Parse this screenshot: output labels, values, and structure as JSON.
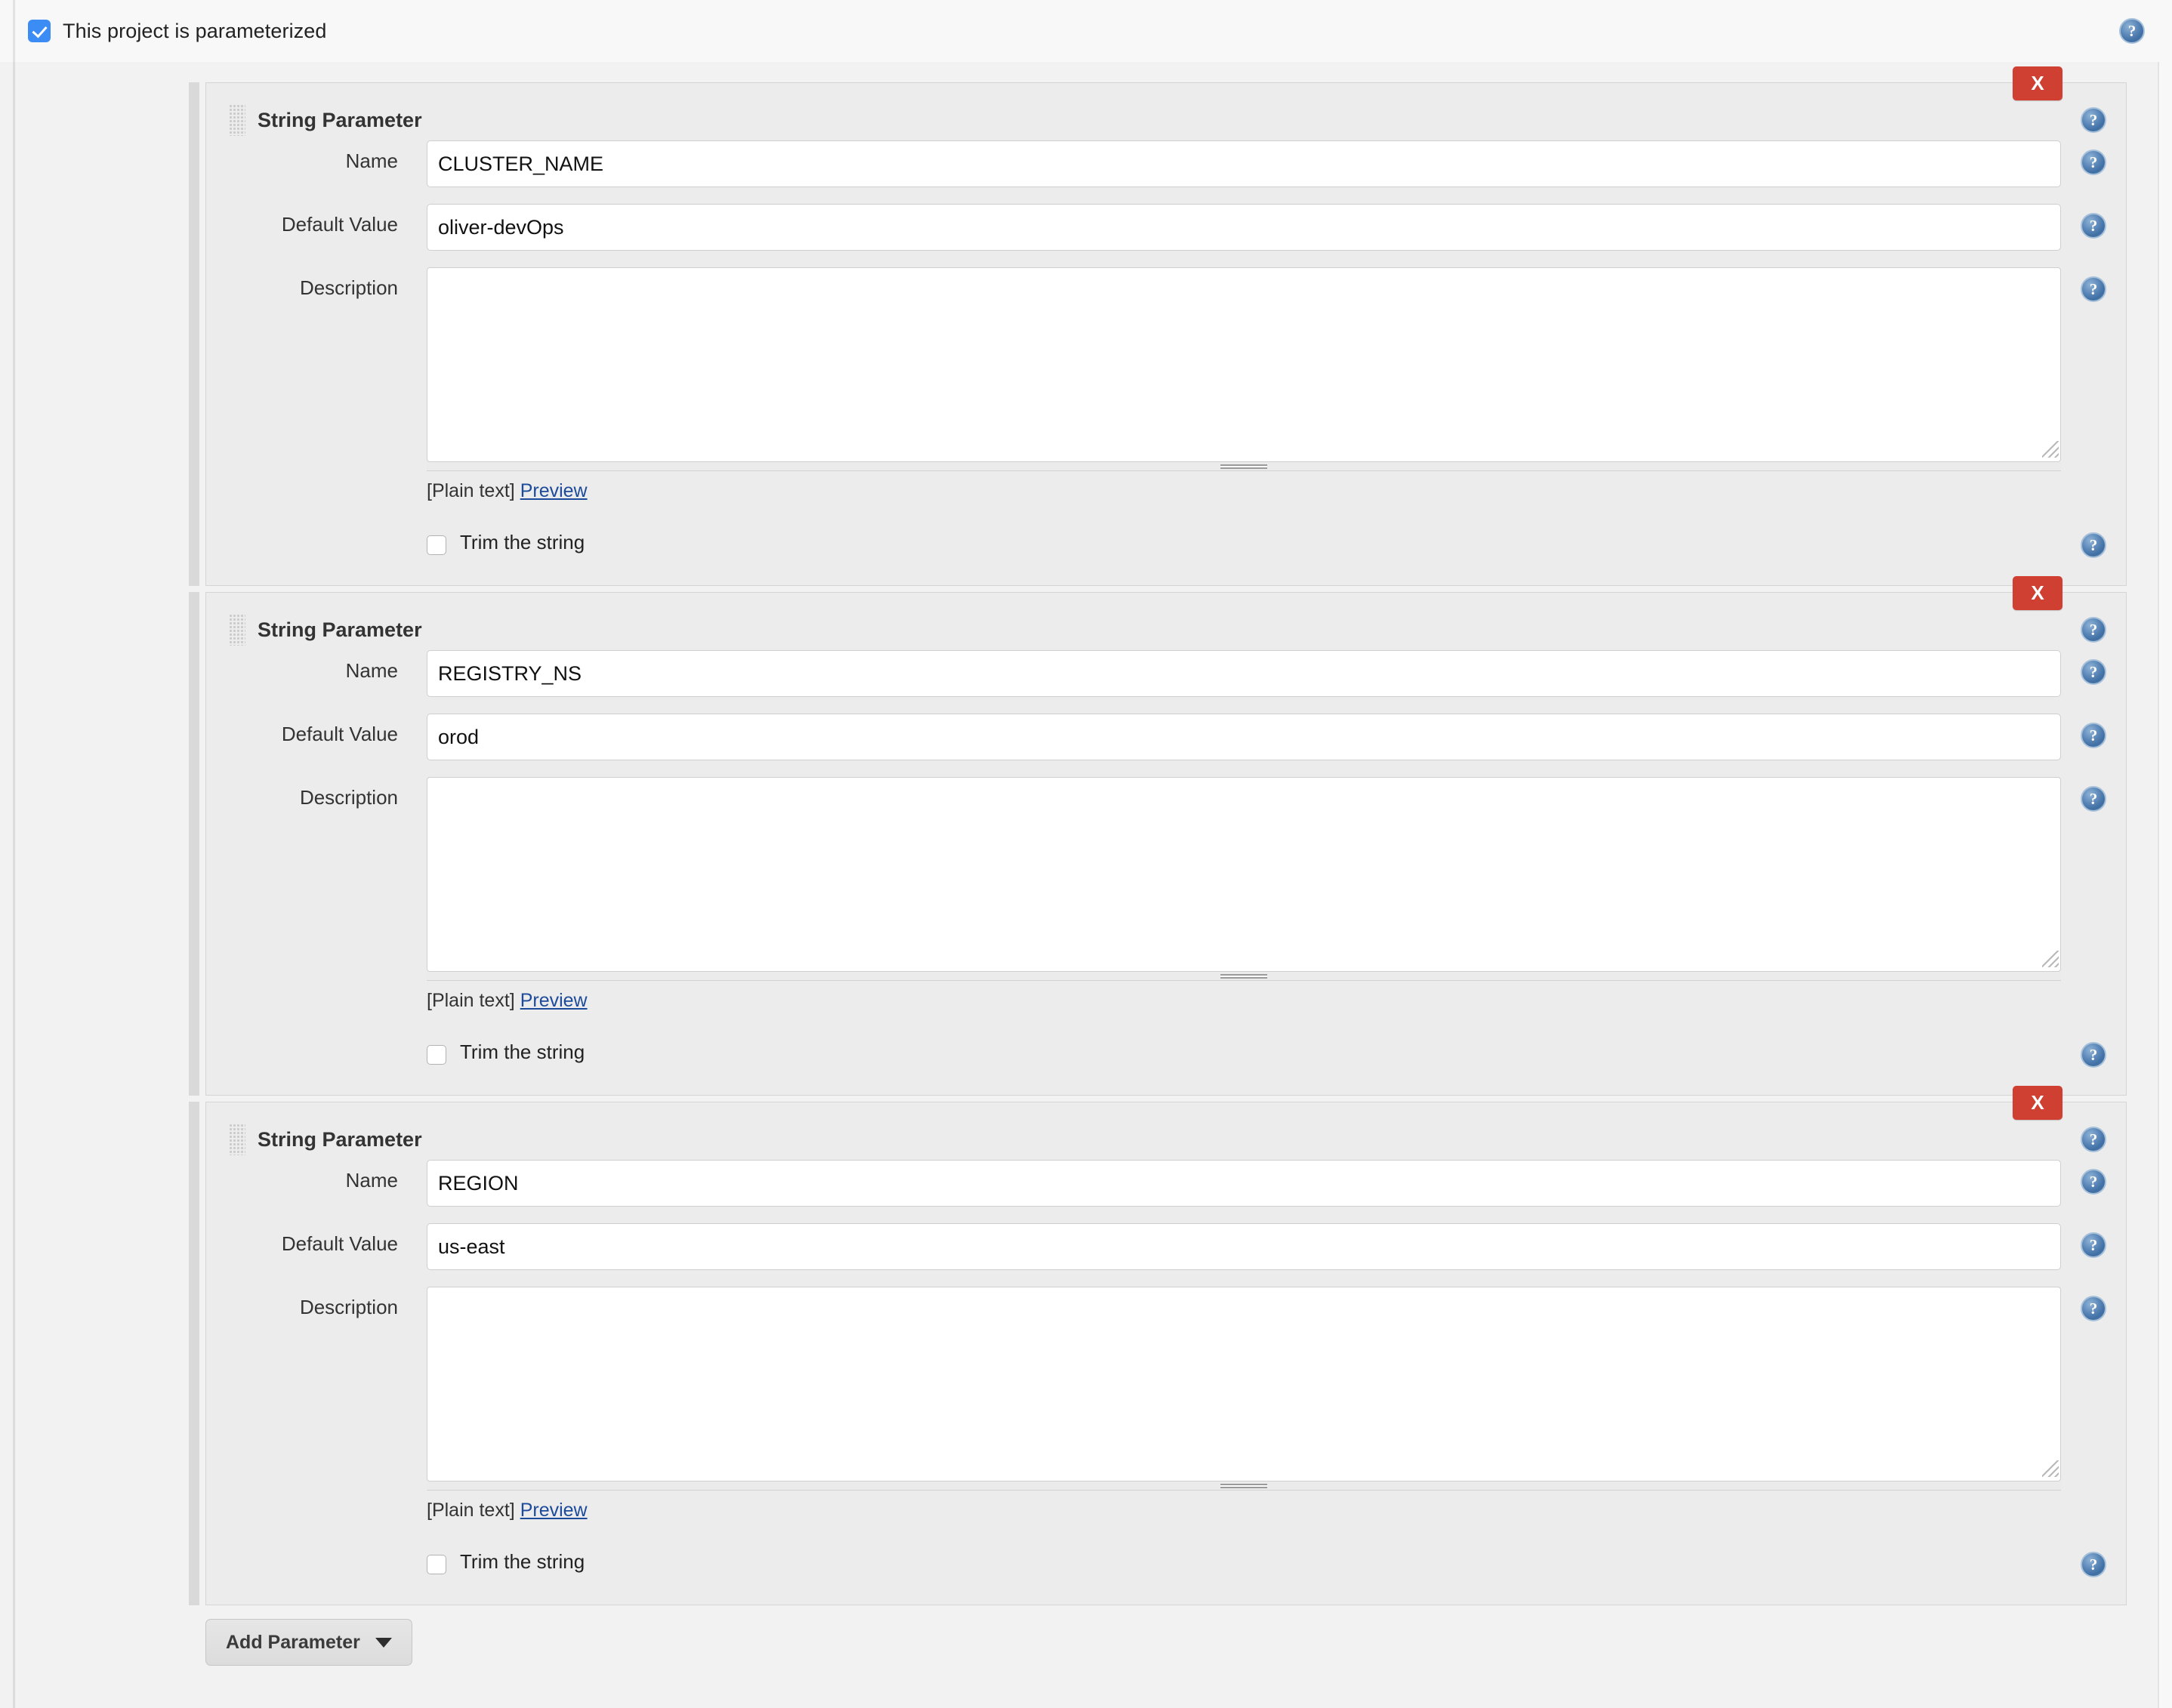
{
  "top": {
    "checkbox_checked": true,
    "label": "This project is parameterized",
    "help_icon": "help-icon",
    "accent_color": "#3b8cf5"
  },
  "labels": {
    "name": "Name",
    "default_value": "Default Value",
    "description": "Description",
    "plain_text": "[Plain text]",
    "preview": "Preview",
    "trim": "Trim the string",
    "delete": "X"
  },
  "colors": {
    "delete_button": "#cf3f32",
    "link": "#1c4b9b",
    "help_icon": "#4d7dad",
    "block_background": "#ececec",
    "page_background": "#f2f2f2"
  },
  "parameters": [
    {
      "type_title": "String Parameter",
      "name": "CLUSTER_NAME",
      "default_value": "oliver-devOps",
      "description": "",
      "description_placeholder": "",
      "trim_checked": false
    },
    {
      "type_title": "String Parameter",
      "name": "REGISTRY_NS",
      "default_value": "orod",
      "description": "",
      "description_placeholder": "",
      "trim_checked": false
    },
    {
      "type_title": "String Parameter",
      "name": "REGION",
      "default_value": "us-east",
      "description": "",
      "description_placeholder": "",
      "trim_checked": false
    }
  ],
  "add_button": {
    "label": "Add Parameter",
    "caret_icon": "chevron-down-icon"
  }
}
